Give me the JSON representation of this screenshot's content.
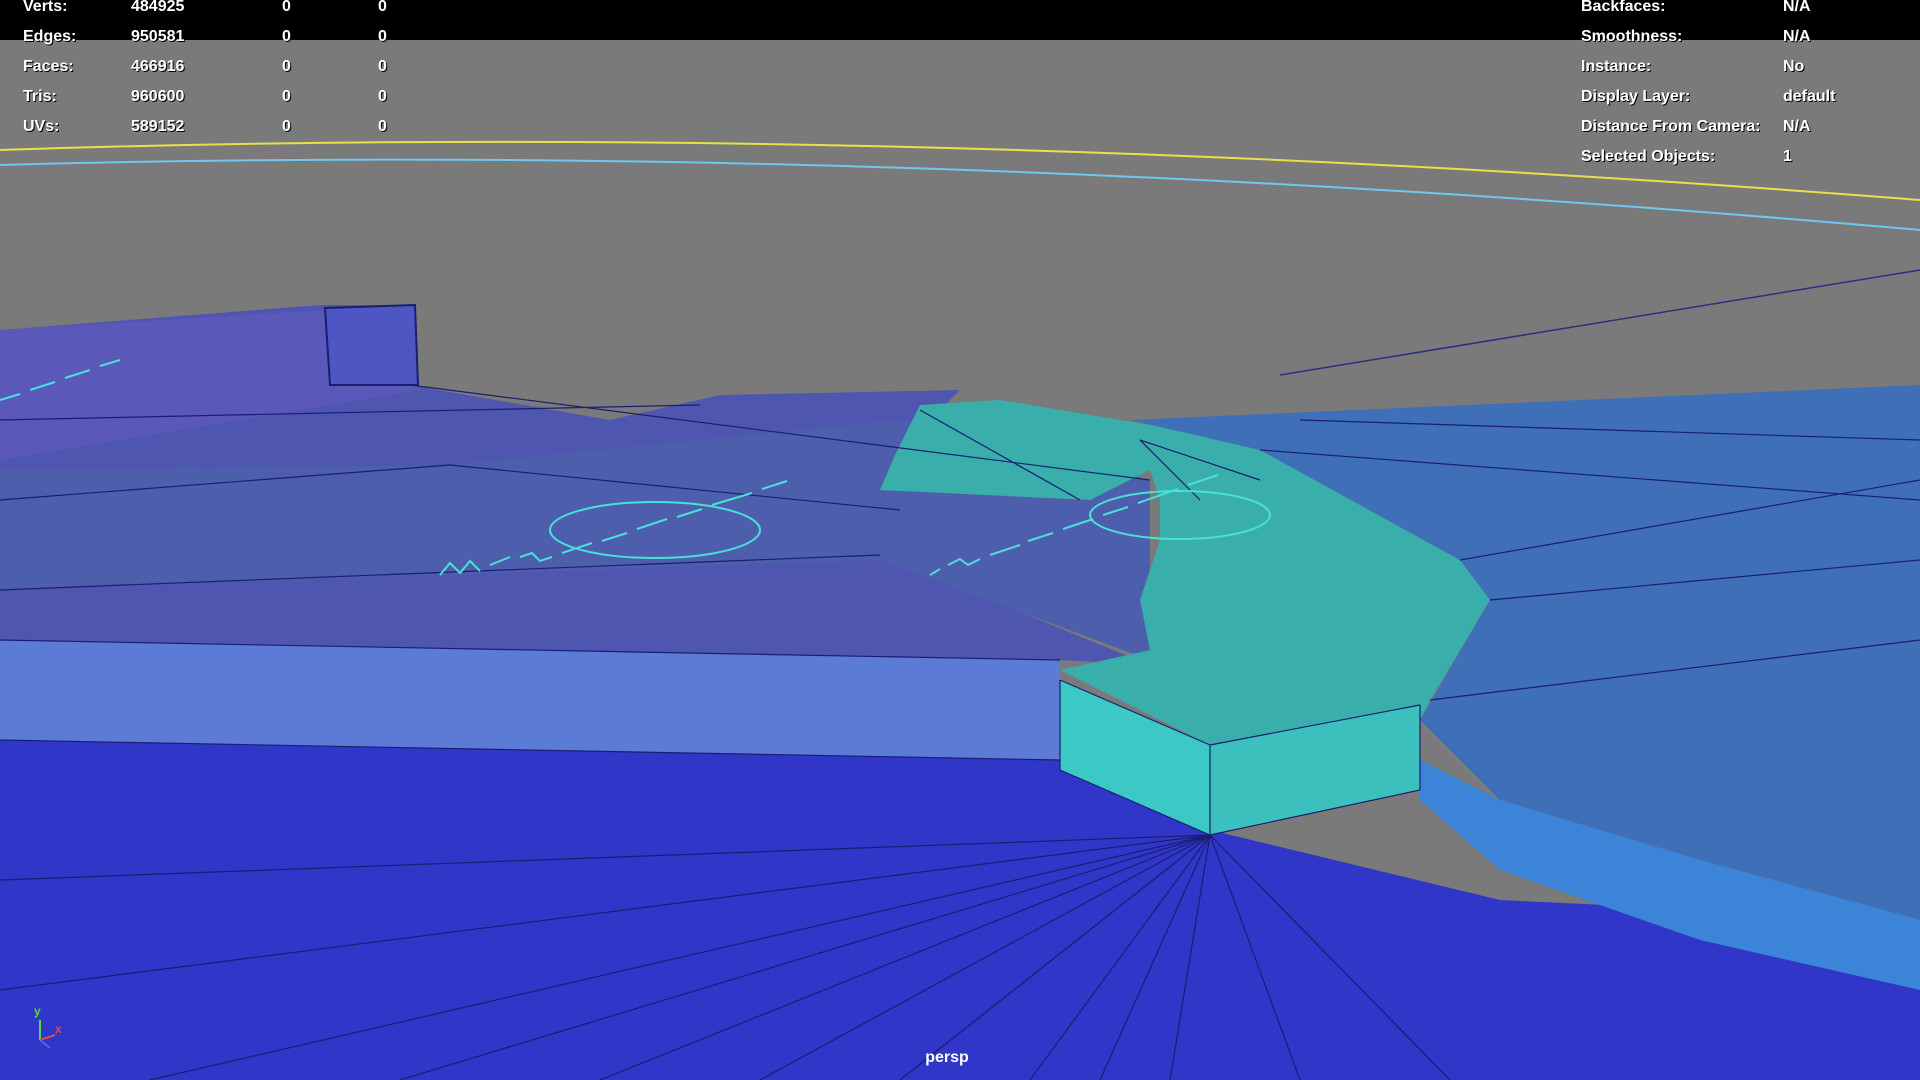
{
  "viewport": {
    "camera": "persp",
    "colors": {
      "background": "#7a7a7a",
      "ground": "#2f36c8",
      "plateau_top": "#4f5eb0",
      "highlight_mesh": "#3cc0be",
      "mesh_right": "#3f6fb6",
      "wire": "#1a1e70",
      "text_wire": "#49e0d8",
      "curve_yellow": "#e8e04a",
      "curve_cyan": "#6fc8ee"
    }
  },
  "stats_left": {
    "rows": [
      {
        "label": "Verts:",
        "value": "484925",
        "c2": "0",
        "c3": "0"
      },
      {
        "label": "Edges:",
        "value": "950581",
        "c2": "0",
        "c3": "0"
      },
      {
        "label": "Faces:",
        "value": "466916",
        "c2": "0",
        "c3": "0"
      },
      {
        "label": "Tris:",
        "value": "960600",
        "c2": "0",
        "c3": "0"
      },
      {
        "label": "UVs:",
        "value": "589152",
        "c2": "0",
        "c3": "0"
      }
    ]
  },
  "stats_right": {
    "rows": [
      {
        "label": "Backfaces:",
        "value": "N/A"
      },
      {
        "label": "Smoothness:",
        "value": "N/A"
      },
      {
        "label": "Instance:",
        "value": "No"
      },
      {
        "label": "Display Layer:",
        "value": "default"
      },
      {
        "label": "Distance From Camera:",
        "value": "N/A"
      },
      {
        "label": "Selected Objects:",
        "value": "1"
      }
    ]
  },
  "axis_gizmo": {
    "y": "y",
    "x": "x"
  }
}
